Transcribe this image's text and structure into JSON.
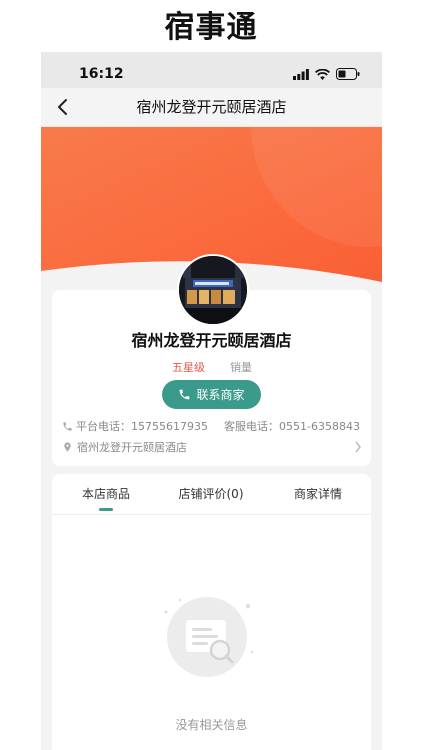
{
  "app_title": "宿事通",
  "status_bar": {
    "time": "16:12"
  },
  "nav": {
    "title": "宿州龙登开元颐居酒店"
  },
  "store": {
    "name": "宿州龙登开元颐居酒店",
    "rating": "五星级",
    "sales_label": "销量",
    "contact_button": "联系商家",
    "platform_phone": "平台电话：15755617935",
    "service_phone": "客服电话：0551-6358843",
    "address": "宿州龙登开元颐居酒店"
  },
  "tabs": [
    {
      "label": "本店商品",
      "active": true
    },
    {
      "label": "店铺评价(0)",
      "active": false
    },
    {
      "label": "商家详情",
      "active": false
    }
  ],
  "empty_state": {
    "text": "没有相关信息"
  },
  "colors": {
    "banner": "#fb6a3e",
    "accent": "#3a9a8b",
    "rating": "#e35b4a"
  },
  "icons": [
    "back-icon",
    "signal-icon",
    "wifi-icon",
    "battery-icon",
    "phone-icon",
    "location-pin-icon",
    "chevron-right-icon",
    "empty-document-icon"
  ]
}
